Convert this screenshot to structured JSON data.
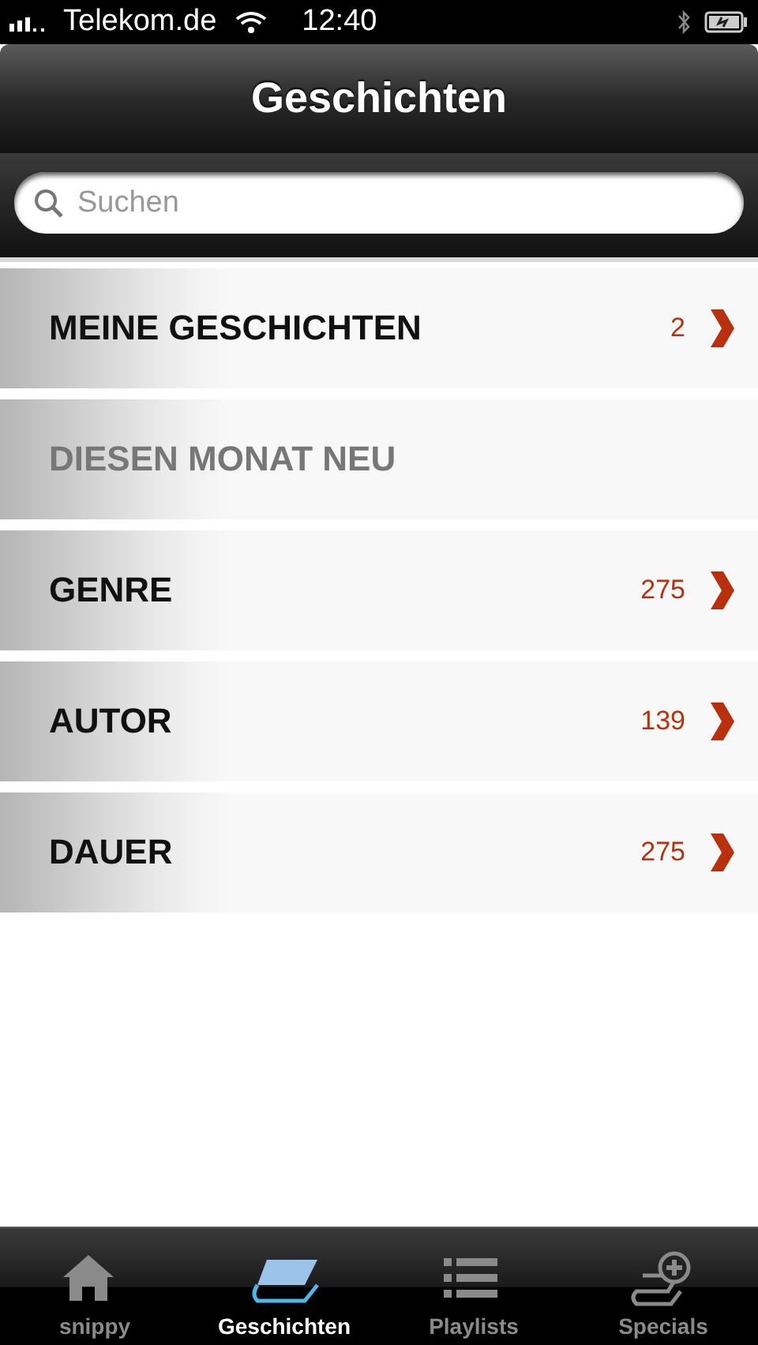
{
  "status_bar": {
    "carrier": "Telekom.de",
    "time": "12:40"
  },
  "nav_bar": {
    "title": "Geschichten"
  },
  "search": {
    "placeholder": "Suchen"
  },
  "rows": [
    {
      "label": "MEINE GESCHICHTEN",
      "count": "2",
      "disabled": false
    },
    {
      "label": "DIESEN MONAT NEU",
      "disabled": true
    },
    {
      "label": "GENRE",
      "count": "275",
      "disabled": false
    },
    {
      "label": "AUTOR",
      "count": "139",
      "disabled": false
    },
    {
      "label": "DAUER",
      "count": "275",
      "disabled": false
    }
  ],
  "tab_bar": [
    {
      "kind": "home",
      "label": "snippy",
      "selected": false
    },
    {
      "kind": "book",
      "label": "Geschichten",
      "selected": true
    },
    {
      "kind": "list",
      "label": "Playlists",
      "selected": false
    },
    {
      "kind": "add",
      "label": "Specials",
      "selected": false
    }
  ]
}
